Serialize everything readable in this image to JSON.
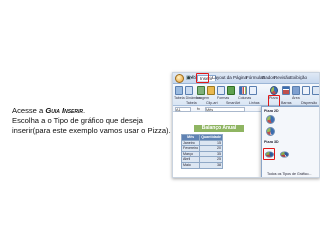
{
  "instruction": {
    "prefix": "Acesse a ",
    "emphasis": "Guia Inserir",
    "suffix": ".",
    "body": "Escolha a o Tipo de gráfico que deseja inserir(para este exemplo vamos usar o Pizza)."
  },
  "excel": {
    "window_title": "Pasta1 - Microsoft Excel",
    "tabs": [
      "Início",
      "Inserir",
      "Layout da Página",
      "Fórmulas",
      "Dados",
      "Revisão",
      "Exibição"
    ],
    "active_tab": "Inserir",
    "ribbon_labels": [
      "Tabela Dinâmica",
      "Tabela",
      "Imagem",
      "Clip-art",
      "Formas",
      "SmartArt",
      "Colunas",
      "Linhas",
      "Pizza",
      "Barras",
      "Área",
      "Dispersão",
      "Outros Gráficos",
      "Hiperlink"
    ],
    "group_labels": [
      "Tabelas",
      "Ilustrações"
    ],
    "name_box": "A1",
    "formula_value": "Mês",
    "sheet_title": "Balanço Anual",
    "table_headers": [
      "Mês",
      "Quantidade"
    ],
    "table_rows": [
      {
        "month": "Janeiro",
        "qty": "15"
      },
      {
        "month": "Fevereiro",
        "qty": "20"
      },
      {
        "month": "Março",
        "qty": "35"
      },
      {
        "month": "Abril",
        "qty": "25"
      },
      {
        "month": "Maio",
        "qty": "38"
      }
    ],
    "dropdown_categories": [
      "Pizza 2D",
      "Pizza 3D"
    ],
    "dropdown_footer": "Todos os Tipos de Gráfico...",
    "colors": {
      "highlight": "#e01818",
      "title_fill": "#8fb562",
      "header_fill": "#5f82b3"
    }
  }
}
